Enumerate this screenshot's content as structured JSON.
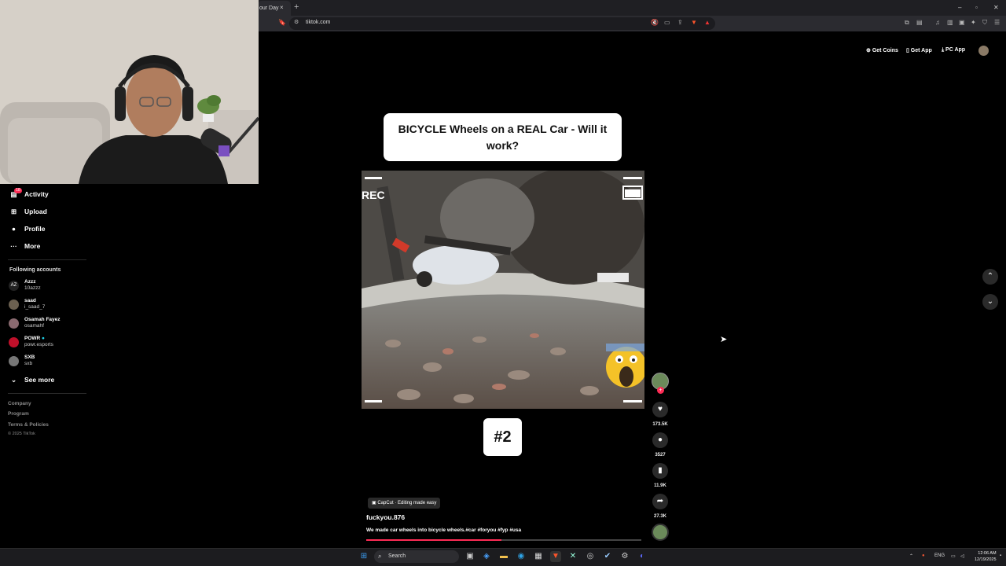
{
  "browser": {
    "tab_title": "our Day",
    "tab_close": "×",
    "new_tab": "+",
    "url": "tiktok.com",
    "window_controls": [
      "–",
      "▫",
      "✕"
    ]
  },
  "header": {
    "get_coins": "Get Coins",
    "get_app": "Get App",
    "pc_app": "PC App"
  },
  "sidebar": {
    "items": [
      {
        "label": "Activity",
        "icon": "activity-icon",
        "badge": "18"
      },
      {
        "label": "Upload",
        "icon": "upload-icon"
      },
      {
        "label": "Profile",
        "icon": "profile-icon"
      },
      {
        "label": "More",
        "icon": "more-icon"
      }
    ],
    "following_header": "Following accounts",
    "accounts": [
      {
        "name": "Azzz",
        "handle": "10azzz"
      },
      {
        "name": "saad",
        "handle": "i_saad_7"
      },
      {
        "name": "Osamah Fayez",
        "handle": "osamahf"
      },
      {
        "name": "POWR",
        "handle": "powr.esports",
        "verified": true
      },
      {
        "name": "SXB",
        "handle": "sxb"
      }
    ],
    "see_more": "See more",
    "footer": [
      "Company",
      "Program",
      "Terms & Policies",
      "© 2025 TikTok"
    ]
  },
  "video": {
    "title": "BICYCLE Wheels on a REAL Car - Will it work?",
    "rec_label": "REC",
    "episode_badge": "#2",
    "capcut_label": "CapCut · Editing made easy",
    "author": "fuckyou.876",
    "caption": "We made car wheels into bicycle wheels.#car #foryou #fyp #usa",
    "progress": 0.49
  },
  "actions": {
    "likes": "173.5K",
    "comments": "3527",
    "saves": "11.9K",
    "shares": "27.3K"
  },
  "taskbar": {
    "search_placeholder": "Search",
    "language": "ENG",
    "time": "12:06 AM",
    "date": "12/19/2025"
  },
  "colors": {
    "accent": "#fe2c55",
    "background": "#000000"
  }
}
